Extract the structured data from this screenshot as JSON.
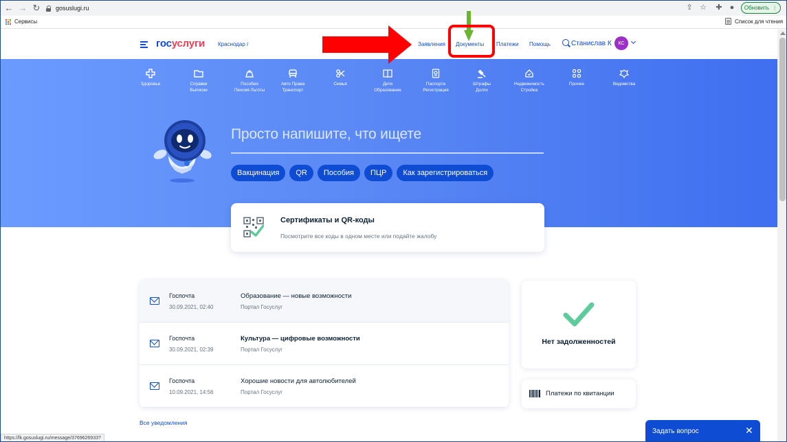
{
  "browser": {
    "url": "gosuslugi.ru",
    "update_label": "Обновить",
    "bookmarks_apps": "Сервисы",
    "reading_list": "Список для чтения",
    "status_url": "https://lk.gosuslugi.ru/message/3769626933?"
  },
  "header": {
    "logo_part1": "гос",
    "logo_part2": "услуги",
    "region": "Краснодар г",
    "nav": [
      "Заявления",
      "Документы",
      "Платежи",
      "Помощь"
    ],
    "user_name": "Станислав К",
    "avatar_initials": "КС"
  },
  "categories": [
    {
      "label": "Здоровье",
      "icon": "health-icon"
    },
    {
      "label": "Справки\nВыписки",
      "icon": "folder-icon"
    },
    {
      "label": "Пособия\nПенсия Льготы",
      "icon": "benefits-icon"
    },
    {
      "label": "Авто Права\nТранспорт",
      "icon": "car-icon"
    },
    {
      "label": "Семья",
      "icon": "family-icon"
    },
    {
      "label": "Дети\nОбразование",
      "icon": "book-icon"
    },
    {
      "label": "Паспорта\nРегистрация",
      "icon": "passport-icon"
    },
    {
      "label": "Штрафы\nДолги",
      "icon": "gavel-icon"
    },
    {
      "label": "Недвижимость\nСтройка",
      "icon": "house-icon"
    },
    {
      "label": "Прочее",
      "icon": "grid-icon"
    },
    {
      "label": "Ведомства",
      "icon": "emblem-icon"
    }
  ],
  "search": {
    "prompt": "Просто напишите, что ищете",
    "chips": [
      "Вакцинация",
      "QR",
      "Пособия",
      "ПЦР",
      "Как зарегистрироваться"
    ]
  },
  "cert_card": {
    "title": "Сертификаты и QR-коды",
    "subtitle": "Посмотрите все коды в одном месте или подайте жалобу"
  },
  "notifications": [
    {
      "sender": "Госпочта",
      "date": "30.09.2021, 02:40",
      "subject": "Образование — новые возможности",
      "source": "Портал Госуслуг",
      "unread": true
    },
    {
      "sender": "Госпочта",
      "date": "30.09.2021, 02:39",
      "subject": "Культура — цифровые возможности",
      "source": "Портал Госуслуг",
      "unread": false
    },
    {
      "sender": "Госпочта",
      "date": "10.09.2021, 14:56",
      "subject": "Хорошие новости для автолюбителей",
      "source": "Портал Госуслуг",
      "unread": false
    }
  ],
  "all_notifications": "Все уведомления",
  "debt_card": {
    "text": "Нет задолженностей"
  },
  "receipt_card": {
    "text": "Платежи по квитанции"
  },
  "ask_widget": {
    "label": "Задать вопрос",
    "close": "✕"
  },
  "colors": {
    "brand_blue": "#0d4cd3",
    "brand_red": "#ee3f58",
    "check_green": "#5fcb9c",
    "annotation_red": "#ff0000",
    "annotation_green": "#6ab42f"
  }
}
